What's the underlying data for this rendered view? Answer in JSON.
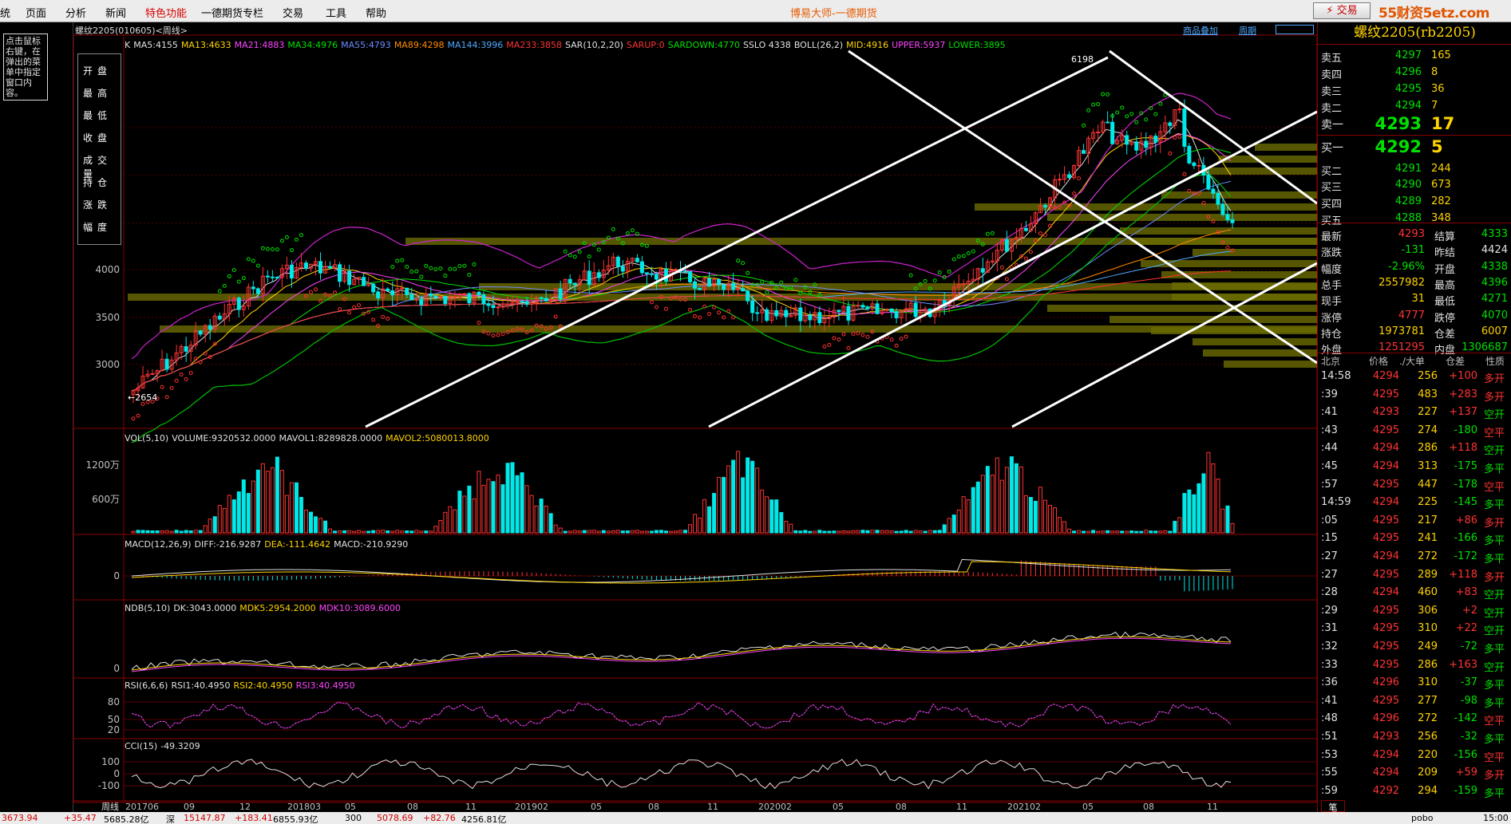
{
  "menu": [
    "统",
    "页面",
    "分析",
    "新闻",
    "特色功能",
    "一德期货专栏",
    "交易",
    "工具",
    "帮助"
  ],
  "app_title": "博易大师-一德期货",
  "trade_button": "⚡ 交易",
  "logo": "55财资5etz.com",
  "left_tip": "点击鼠标右键，在弹出的菜单中指定窗口内容。",
  "chart": {
    "title": "螺纹2205(010605)<周线>",
    "toolbar": [
      "商品叠加",
      "周期"
    ],
    "ohlc_labels": [
      "开盘",
      "最高",
      "最低",
      "收盘",
      "成交量",
      "持仓",
      "涨跌",
      "幅度"
    ],
    "price_ticks": [
      "4000",
      "3500",
      "3000"
    ],
    "hi_label": "6198",
    "lo_label": "←2654",
    "ma_legend": [
      {
        "text": "K",
        "color": "#e0e0e0"
      },
      {
        "text": "MA5:4155",
        "color": "#e0e0e0"
      },
      {
        "text": "MA13:4633",
        "color": "#ffd400"
      },
      {
        "text": "MA21:4883",
        "color": "#ff44ff"
      },
      {
        "text": "MA34:4976",
        "color": "#00e000"
      },
      {
        "text": "MA55:4793",
        "color": "#6c8cff"
      },
      {
        "text": "MA89:4298",
        "color": "#ff8c00"
      },
      {
        "text": "MA144:3996",
        "color": "#4fa8ff"
      },
      {
        "text": "MA233:3858",
        "color": "#ff3333"
      },
      {
        "text": "SAR(10,2,20)",
        "color": "#e0e0e0"
      },
      {
        "text": "SARUP:0",
        "color": "#ff3333"
      },
      {
        "text": "SARDOWN:4770",
        "color": "#00e000"
      },
      {
        "text": "SSLO 4338",
        "color": "#e0e0e0"
      },
      {
        "text": "BOLL(26,2)",
        "color": "#e0e0e0"
      },
      {
        "text": "MID:4916",
        "color": "#ffd400"
      },
      {
        "text": "UPPER:5937",
        "color": "#ff44ff"
      },
      {
        "text": "LOWER:3895",
        "color": "#00e000"
      }
    ],
    "vol_legend": [
      {
        "text": "VOL(5,10)",
        "color": "#e0e0e0"
      },
      {
        "text": "VOLUME:9320532.0000",
        "color": "#e0e0e0"
      },
      {
        "text": "MAVOL1:8289828.0000",
        "color": "#e0e0e0"
      },
      {
        "text": "MAVOL2:5080013.8000",
        "color": "#ffd400"
      }
    ],
    "vol_ticks": [
      "1200万",
      "600万"
    ],
    "macd_legend": [
      {
        "text": "MACD(12,26,9)",
        "color": "#e0e0e0"
      },
      {
        "text": "DIFF:-216.9287",
        "color": "#e0e0e0"
      },
      {
        "text": "DEA:-111.4642",
        "color": "#ffd400"
      },
      {
        "text": "MACD:-210.9290",
        "color": "#e0e0e0"
      }
    ],
    "macd_ticks": [
      "0"
    ],
    "ndb_legend": [
      {
        "text": "NDB(5,10)",
        "color": "#e0e0e0"
      },
      {
        "text": "DK:3043.0000",
        "color": "#e0e0e0"
      },
      {
        "text": "MDK5:2954.2000",
        "color": "#ffd400"
      },
      {
        "text": "MDK10:3089.6000",
        "color": "#ff44ff"
      }
    ],
    "ndb_ticks": [
      "0"
    ],
    "rsi_legend": [
      {
        "text": "RSI(6,6,6)",
        "color": "#e0e0e0"
      },
      {
        "text": "RSI1:40.4950",
        "color": "#e0e0e0"
      },
      {
        "text": "RSI2:40.4950",
        "color": "#ffd400"
      },
      {
        "text": "RSI3:40.4950",
        "color": "#ff44ff"
      }
    ],
    "rsi_ticks": [
      "80",
      "50",
      "20"
    ],
    "cci_legend": [
      {
        "text": "CCI(15)",
        "color": "#e0e0e0"
      },
      {
        "text": "-49.3209",
        "color": "#e0e0e0"
      }
    ],
    "cci_ticks": [
      "100",
      "0",
      "-100"
    ],
    "period_label": "周线",
    "x_labels": [
      "201706",
      "09",
      "12",
      "201803",
      "05",
      "08",
      "11",
      "201902",
      "05",
      "08",
      "11",
      "202002",
      "05",
      "08",
      "11",
      "202102",
      "05",
      "08",
      "11"
    ]
  },
  "quote": {
    "title": "螺纹2205(rb2205)",
    "asks": [
      {
        "label": "卖五",
        "price": "4297",
        "vol": "165"
      },
      {
        "label": "卖四",
        "price": "4296",
        "vol": "8"
      },
      {
        "label": "卖三",
        "price": "4295",
        "vol": "36"
      },
      {
        "label": "卖二",
        "price": "4294",
        "vol": "7"
      },
      {
        "label": "卖一",
        "price": "4293",
        "vol": "17"
      }
    ],
    "bids": [
      {
        "label": "买一",
        "price": "4292",
        "vol": "5"
      },
      {
        "label": "买二",
        "price": "4291",
        "vol": "244"
      },
      {
        "label": "买三",
        "price": "4290",
        "vol": "673"
      },
      {
        "label": "买四",
        "price": "4289",
        "vol": "282"
      },
      {
        "label": "买五",
        "price": "4288",
        "vol": "348"
      }
    ],
    "stats": [
      {
        "l1": "最新",
        "v1": "4293",
        "c1": "red",
        "l2": "结算",
        "v2": "4333",
        "c2": "green"
      },
      {
        "l1": "涨跌",
        "v1": "-131",
        "c1": "green",
        "l2": "昨结",
        "v2": "4424",
        "c2": "white"
      },
      {
        "l1": "幅度",
        "v1": "-2.96%",
        "c1": "green",
        "l2": "开盘",
        "v2": "4338",
        "c2": "green"
      },
      {
        "l1": "总手",
        "v1": "2557982",
        "c1": "yellow",
        "l2": "最高",
        "v2": "4396",
        "c2": "green"
      },
      {
        "l1": "现手",
        "v1": "31",
        "c1": "yellow",
        "l2": "最低",
        "v2": "4271",
        "c2": "green"
      },
      {
        "l1": "涨停",
        "v1": "4777",
        "c1": "red",
        "l2": "跌停",
        "v2": "4070",
        "c2": "green"
      },
      {
        "l1": "持仓",
        "v1": "1973781",
        "c1": "yellow",
        "l2": "仓差",
        "v2": "6007",
        "c2": "yellow"
      },
      {
        "l1": "外盘",
        "v1": "1251295",
        "c1": "red",
        "l2": "内盘",
        "v2": "1306687",
        "c2": "green"
      }
    ],
    "tick_headers": [
      "北京",
      "价格",
      "./大单",
      "仓差",
      "性质"
    ],
    "ticks": [
      {
        "t": "14:58",
        "p": "4294",
        "v": "256",
        "c": "+100",
        "cc": "red",
        "n": "多开",
        "nc": "red"
      },
      {
        "t": ":39",
        "p": "4295",
        "v": "483",
        "c": "+283",
        "cc": "red",
        "n": "多开",
        "nc": "red"
      },
      {
        "t": ":41",
        "p": "4293",
        "v": "227",
        "c": "+137",
        "cc": "red",
        "n": "空开",
        "nc": "green"
      },
      {
        "t": ":43",
        "p": "4295",
        "v": "274",
        "c": "-180",
        "cc": "green",
        "n": "空平",
        "nc": "red"
      },
      {
        "t": ":44",
        "p": "4294",
        "v": "286",
        "c": "+118",
        "cc": "red",
        "n": "空开",
        "nc": "green"
      },
      {
        "t": ":45",
        "p": "4294",
        "v": "313",
        "c": "-175",
        "cc": "green",
        "n": "多平",
        "nc": "green"
      },
      {
        "t": ":57",
        "p": "4295",
        "v": "447",
        "c": "-178",
        "cc": "green",
        "n": "空平",
        "nc": "red"
      },
      {
        "t": "14:59",
        "p": "4294",
        "v": "225",
        "c": "-145",
        "cc": "green",
        "n": "多平",
        "nc": "green"
      },
      {
        "t": ":05",
        "p": "4295",
        "v": "217",
        "c": "+86",
        "cc": "red",
        "n": "多开",
        "nc": "red"
      },
      {
        "t": ":15",
        "p": "4295",
        "v": "241",
        "c": "-166",
        "cc": "green",
        "n": "多平",
        "nc": "green"
      },
      {
        "t": ":27",
        "p": "4294",
        "v": "272",
        "c": "-172",
        "cc": "green",
        "n": "多平",
        "nc": "green"
      },
      {
        "t": ":27",
        "p": "4295",
        "v": "289",
        "c": "+118",
        "cc": "red",
        "n": "多开",
        "nc": "red"
      },
      {
        "t": ":28",
        "p": "4294",
        "v": "460",
        "c": "+83",
        "cc": "red",
        "n": "空开",
        "nc": "green"
      },
      {
        "t": ":29",
        "p": "4295",
        "v": "306",
        "c": "+2",
        "cc": "red",
        "n": "空开",
        "nc": "green"
      },
      {
        "t": ":31",
        "p": "4295",
        "v": "310",
        "c": "+22",
        "cc": "red",
        "n": "空开",
        "nc": "green"
      },
      {
        "t": ":32",
        "p": "4295",
        "v": "249",
        "c": "-72",
        "cc": "green",
        "n": "多平",
        "nc": "green"
      },
      {
        "t": ":33",
        "p": "4295",
        "v": "286",
        "c": "+163",
        "cc": "red",
        "n": "空开",
        "nc": "green"
      },
      {
        "t": ":36",
        "p": "4296",
        "v": "310",
        "c": "-37",
        "cc": "green",
        "n": "多平",
        "nc": "green"
      },
      {
        "t": ":41",
        "p": "4295",
        "v": "277",
        "c": "-98",
        "cc": "green",
        "n": "多平",
        "nc": "green"
      },
      {
        "t": ":48",
        "p": "4296",
        "v": "272",
        "c": "-142",
        "cc": "green",
        "n": "空平",
        "nc": "red"
      },
      {
        "t": ":51",
        "p": "4293",
        "v": "256",
        "c": "-32",
        "cc": "green",
        "n": "多平",
        "nc": "green"
      },
      {
        "t": ":53",
        "p": "4294",
        "v": "220",
        "c": "-156",
        "cc": "green",
        "n": "空平",
        "nc": "red"
      },
      {
        "t": ":55",
        "p": "4294",
        "v": "209",
        "c": "+59",
        "cc": "red",
        "n": "多开",
        "nc": "red"
      },
      {
        "t": ":59",
        "p": "4292",
        "v": "294",
        "c": "-159",
        "cc": "green",
        "n": "多平",
        "nc": "green"
      }
    ],
    "bottom_tab": "笔"
  },
  "status": [
    {
      "text": "3673.94",
      "color": "#d00000"
    },
    {
      "text": "+35.47",
      "color": "#d00000"
    },
    {
      "text": "5685.28亿",
      "color": "#000"
    },
    {
      "text": "深",
      "color": "#000"
    },
    {
      "text": "15147.87",
      "color": "#d00000"
    },
    {
      "text": "+183.41",
      "color": "#d00000"
    },
    {
      "text": "6855.93亿",
      "color": "#000"
    },
    {
      "text": "300",
      "color": "#000"
    },
    {
      "text": "5078.69",
      "color": "#d00000"
    },
    {
      "text": "+82.76",
      "color": "#d00000"
    },
    {
      "text": "4256.81亿",
      "color": "#000"
    },
    {
      "text": "pobo",
      "color": "#000"
    },
    {
      "text": "15:00",
      "color": "#000"
    }
  ]
}
